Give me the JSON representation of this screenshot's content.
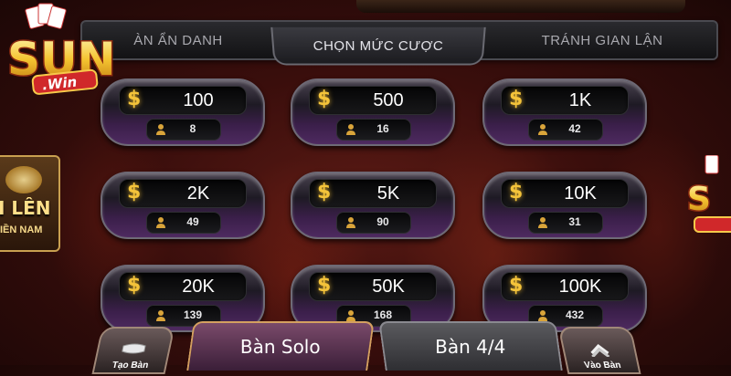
{
  "tabs": [
    {
      "label": "ÀN ẨN DANH",
      "active": false
    },
    {
      "label": "CHỌN MỨC CƯỢC",
      "active": true
    },
    {
      "label": "TRÁNH GIAN LẬN",
      "active": false
    }
  ],
  "logo": {
    "brand": "SUN",
    "sub": ".Win"
  },
  "side_banner": {
    "line1": "I LÊN",
    "line2": "IỀN NAM"
  },
  "currency_symbol": "$",
  "bets": [
    {
      "amount": "100",
      "players": "8"
    },
    {
      "amount": "500",
      "players": "16"
    },
    {
      "amount": "1K",
      "players": "42"
    },
    {
      "amount": "2K",
      "players": "49"
    },
    {
      "amount": "5K",
      "players": "90"
    },
    {
      "amount": "10K",
      "players": "31"
    },
    {
      "amount": "20K",
      "players": "139"
    },
    {
      "amount": "50K",
      "players": "168"
    },
    {
      "amount": "100K",
      "players": "432"
    }
  ],
  "bottom": {
    "create_label": "Tạo Bàn",
    "solo_label": "Bàn Solo",
    "four_label": "Bàn 4/4",
    "join_label": "Vào Bàn"
  },
  "colors": {
    "gold": "#f4c33a",
    "background": "#3a0e0c",
    "pill_purple": "#4e2a60"
  }
}
